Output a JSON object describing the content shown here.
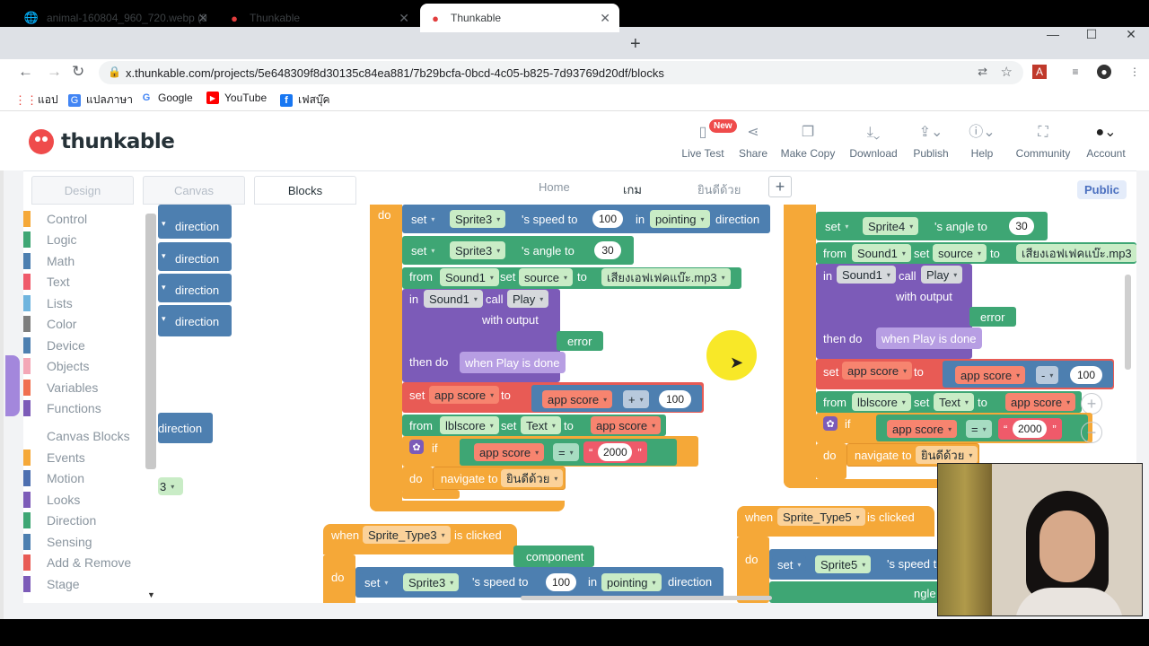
{
  "browser": {
    "tabs": [
      {
        "label": "animal-160804_960_720.webp (9",
        "active": false
      },
      {
        "label": "Thunkable",
        "active": false
      },
      {
        "label": "Thunkable",
        "active": true
      }
    ],
    "url": "x.thunkable.com/projects/5e648309f8d30135c84ea881/7b29bcfa-0bcd-4c05-b825-7d93769d20df/blocks",
    "bookmarks": [
      {
        "label": "แอป",
        "icon": "apps-grid-icon"
      },
      {
        "label": "แปลภาษา",
        "icon": "translate-icon"
      },
      {
        "label": "Google",
        "icon": "google-icon"
      },
      {
        "label": "YouTube",
        "icon": "youtube-icon"
      },
      {
        "label": "เฟสบุ๊ค",
        "icon": "facebook-icon"
      }
    ]
  },
  "app": {
    "logo": "thunkable",
    "header_buttons": [
      {
        "label": "Live Test",
        "icon": "phone-icon"
      },
      {
        "label": "Share",
        "icon": "share-icon"
      },
      {
        "label": "Make Copy",
        "icon": "copy-icon"
      },
      {
        "label": "Download",
        "icon": "download-icon"
      },
      {
        "label": "Publish",
        "icon": "publish-icon"
      },
      {
        "label": "Help",
        "icon": "help-icon"
      },
      {
        "label": "Community",
        "icon": "community-icon"
      },
      {
        "label": "Account",
        "icon": "avatar-icon"
      }
    ],
    "new_badge": "New",
    "editor_tabs": [
      "Design",
      "Canvas",
      "Blocks"
    ],
    "screen_tabs": [
      "Home",
      "เกม",
      "ยินดีด้วย"
    ],
    "public_label": "Public"
  },
  "palette": {
    "items": [
      {
        "label": "Control",
        "color": "#f5a838"
      },
      {
        "label": "Logic",
        "color": "#3ea674"
      },
      {
        "label": "Math",
        "color": "#4d7fb0"
      },
      {
        "label": "Text",
        "color": "#ef5a6a"
      },
      {
        "label": "Lists",
        "color": "#6fb4de"
      },
      {
        "label": "Color",
        "color": "#7d7d7d"
      },
      {
        "label": "Device",
        "color": "#4d7fb0"
      },
      {
        "label": "Objects",
        "color": "#f3a7b6"
      },
      {
        "label": "Variables",
        "color": "#f06f4f"
      },
      {
        "label": "Functions",
        "color": "#7c5bb8"
      },
      {
        "label": "Canvas Blocks",
        "color": "#ffffff"
      },
      {
        "label": "Events",
        "color": "#f5a838"
      },
      {
        "label": "Motion",
        "color": "#4d6fb0"
      },
      {
        "label": "Looks",
        "color": "#7c5bb8"
      },
      {
        "label": "Direction",
        "color": "#3ea674"
      },
      {
        "label": "Sensing",
        "color": "#4d7fb0"
      },
      {
        "label": "Add & Remove",
        "color": "#e85b55"
      },
      {
        "label": "Stage",
        "color": "#7c5bb8"
      }
    ]
  },
  "blocks": {
    "kw_do": "do",
    "kw_set": "set",
    "kw_from": "from",
    "kw_in": "in",
    "kw_call": "call",
    "kw_to": "to",
    "kw_if": "if",
    "kw_when": "when",
    "kw_then_do": "then do",
    "kw_with_output": "with output",
    "kw_is_clicked": "is clicked",
    "speed_to": "'s speed to",
    "angle_to": "'s angle to",
    "pointing": "pointing",
    "direction": "direction",
    "sprite3": "Sprite3",
    "sprite4": "Sprite4",
    "sprite5": "Sprite5",
    "sound1": "Sound1",
    "source": "source",
    "play": "Play",
    "error": "error",
    "play_done": "when Play is done",
    "app_score": "app score",
    "lblscore": "lblscore",
    "text": "Text",
    "plus": "+",
    "minus": "-",
    "equals": "=",
    "navigate_to": "navigate to",
    "screen_target": "ยินดีด้วย",
    "sound_file": "เสียงเอฟเฟคแบ๊ะ.mp3",
    "sound_file_cut": "เสียงเอฟเฟคแบ๊ะ.mp3",
    "n100": "100",
    "n30": "30",
    "n2000": "2000",
    "n3": "3",
    "sprite_type3": "Sprite_Type3",
    "sprite_type5": "Sprite_Type5",
    "component": "component",
    "quote_open": "“",
    "quote_close": "”",
    "speed_t_cut": "'s speed t",
    "angle_cut": "ngle t"
  }
}
